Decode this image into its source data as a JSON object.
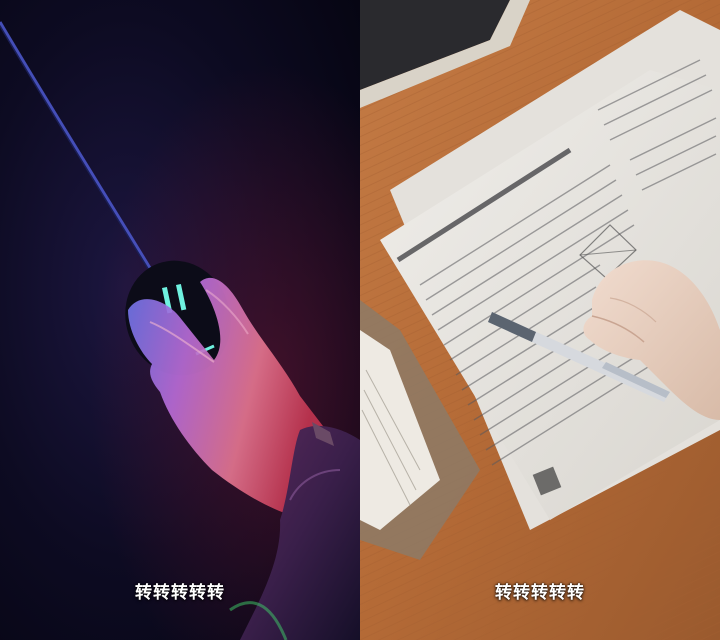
{
  "panels": [
    {
      "subtitle": "转转转转转",
      "scene": "hand-on-gaming-mouse-neon-light",
      "colors": {
        "background": "#0b0a1a",
        "accent_red": "#d6243f",
        "accent_blue": "#2b3fb3",
        "mouse_glow": "#6ff2e0"
      }
    },
    {
      "subtitle": "转转转转转",
      "scene": "hand-with-pen-over-exam-paper-on-desk",
      "colors": {
        "desk": "#b86a38",
        "paper": "#e9e6e1",
        "ink": "#4a4a4a"
      }
    }
  ]
}
